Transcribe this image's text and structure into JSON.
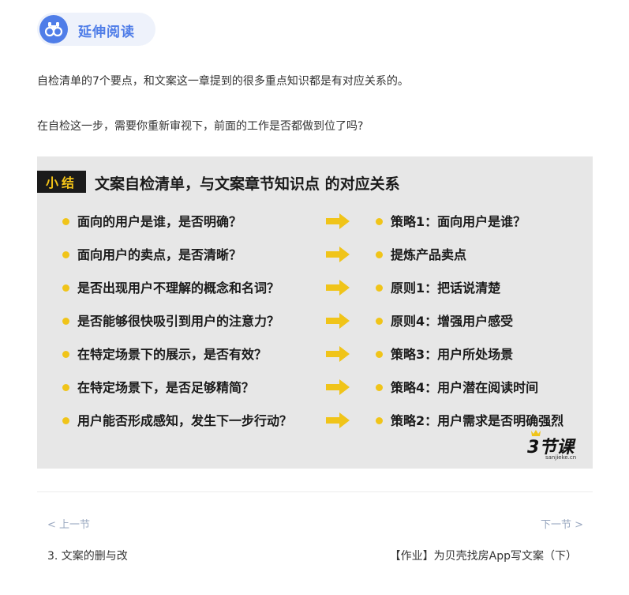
{
  "section_badge": {
    "label": "延伸阅读",
    "icon": "binoculars-icon",
    "accent": "#4f7de8"
  },
  "paragraphs": [
    "自检清单的7个要点，和文案这一章提到的很多重点知识都是有对应关系的。",
    "在自检这一步，需要你重新审视下，前面的工作是否都做到位了吗?"
  ],
  "summary": {
    "tag": "小结",
    "title": "文案自检清单，与文案章节知识点 的对应关系",
    "rows": [
      {
        "question": "面向的用户是谁，是否明确？",
        "answer": "策略1：面向用户是谁？"
      },
      {
        "question": "面向用户的卖点，是否清晰？",
        "answer": "提炼产品卖点"
      },
      {
        "question": "是否出现用户不理解的概念和名词？",
        "answer": "原则1：把话说清楚"
      },
      {
        "question": "是否能够很快吸引到用户的注意力？",
        "answer": "原则4：增强用户感受"
      },
      {
        "question": "在特定场景下的展示，是否有效？",
        "answer": "策略3：用户所处场景"
      },
      {
        "question": "在特定场景下，是否足够精简？",
        "answer": "策略4：用户潜在阅读时间"
      },
      {
        "question": "用户能否形成感知，发生下一步行动？",
        "answer": "策略2：用户需求是否明确强烈"
      }
    ],
    "logo_text": "3节课",
    "logo_domain": "sanjieke.cn",
    "colors": {
      "bullet": "#f0c419",
      "arrow": "#f0c419",
      "panel": "#e7e7e7"
    }
  },
  "navigation": {
    "prev_label": "< 上一节",
    "next_label": "下一节 >",
    "prev_title": "3. 文案的删与改",
    "next_title": "【作业】为贝壳找房App写文案（下）"
  }
}
